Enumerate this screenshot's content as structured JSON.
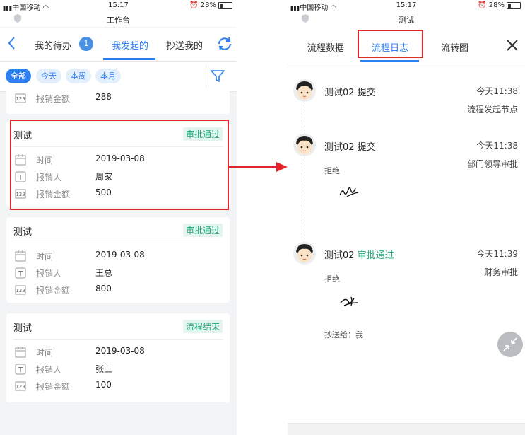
{
  "left": {
    "status_bar": {
      "carrier": "中国移动",
      "time": "15:17",
      "battery": "28%"
    },
    "title": "工作台",
    "tabs": [
      {
        "label": "我的待办",
        "badge": "1"
      },
      {
        "label": "我发起的"
      },
      {
        "label": "抄送我的"
      }
    ],
    "filters": [
      "全部",
      "今天",
      "本周",
      "本月"
    ],
    "partial_card": {
      "label": "报销金额",
      "value": "288"
    },
    "cards": [
      {
        "title": "测试",
        "status": "审批通过",
        "rows": [
          {
            "label": "时间",
            "value": "2019-03-08"
          },
          {
            "label": "报销人",
            "value": "周家"
          },
          {
            "label": "报销金额",
            "value": "500"
          }
        ]
      },
      {
        "title": "测试",
        "status": "审批通过",
        "rows": [
          {
            "label": "时间",
            "value": "2019-03-08"
          },
          {
            "label": "报销人",
            "value": "王总"
          },
          {
            "label": "报销金额",
            "value": "800"
          }
        ]
      },
      {
        "title": "测试",
        "status": "流程结束",
        "rows": [
          {
            "label": "时间",
            "value": "2019-03-08"
          },
          {
            "label": "报销人",
            "value": "张三"
          },
          {
            "label": "报销金额",
            "value": "100"
          }
        ]
      }
    ]
  },
  "right": {
    "status_bar": {
      "carrier": "中国移动",
      "time": "15:17",
      "battery": "28%"
    },
    "title": "测试",
    "tabs": [
      "流程数据",
      "流程日志",
      "流转图"
    ],
    "entries": [
      {
        "name": "测试02",
        "action": "提交",
        "time": "今天11:38",
        "node": "流程发起节点"
      },
      {
        "name": "测试02",
        "action": "提交",
        "time": "今天11:38",
        "node": "部门领导审批",
        "result": "拒绝"
      },
      {
        "name": "测试02",
        "action": "审批通过",
        "time": "今天11:39",
        "node": "财务审批",
        "result": "拒绝",
        "cc": "抄送给：我"
      }
    ]
  },
  "colors": {
    "accent": "#2e7ff2",
    "success": "#22a87a",
    "highlight": "#e3242b"
  }
}
